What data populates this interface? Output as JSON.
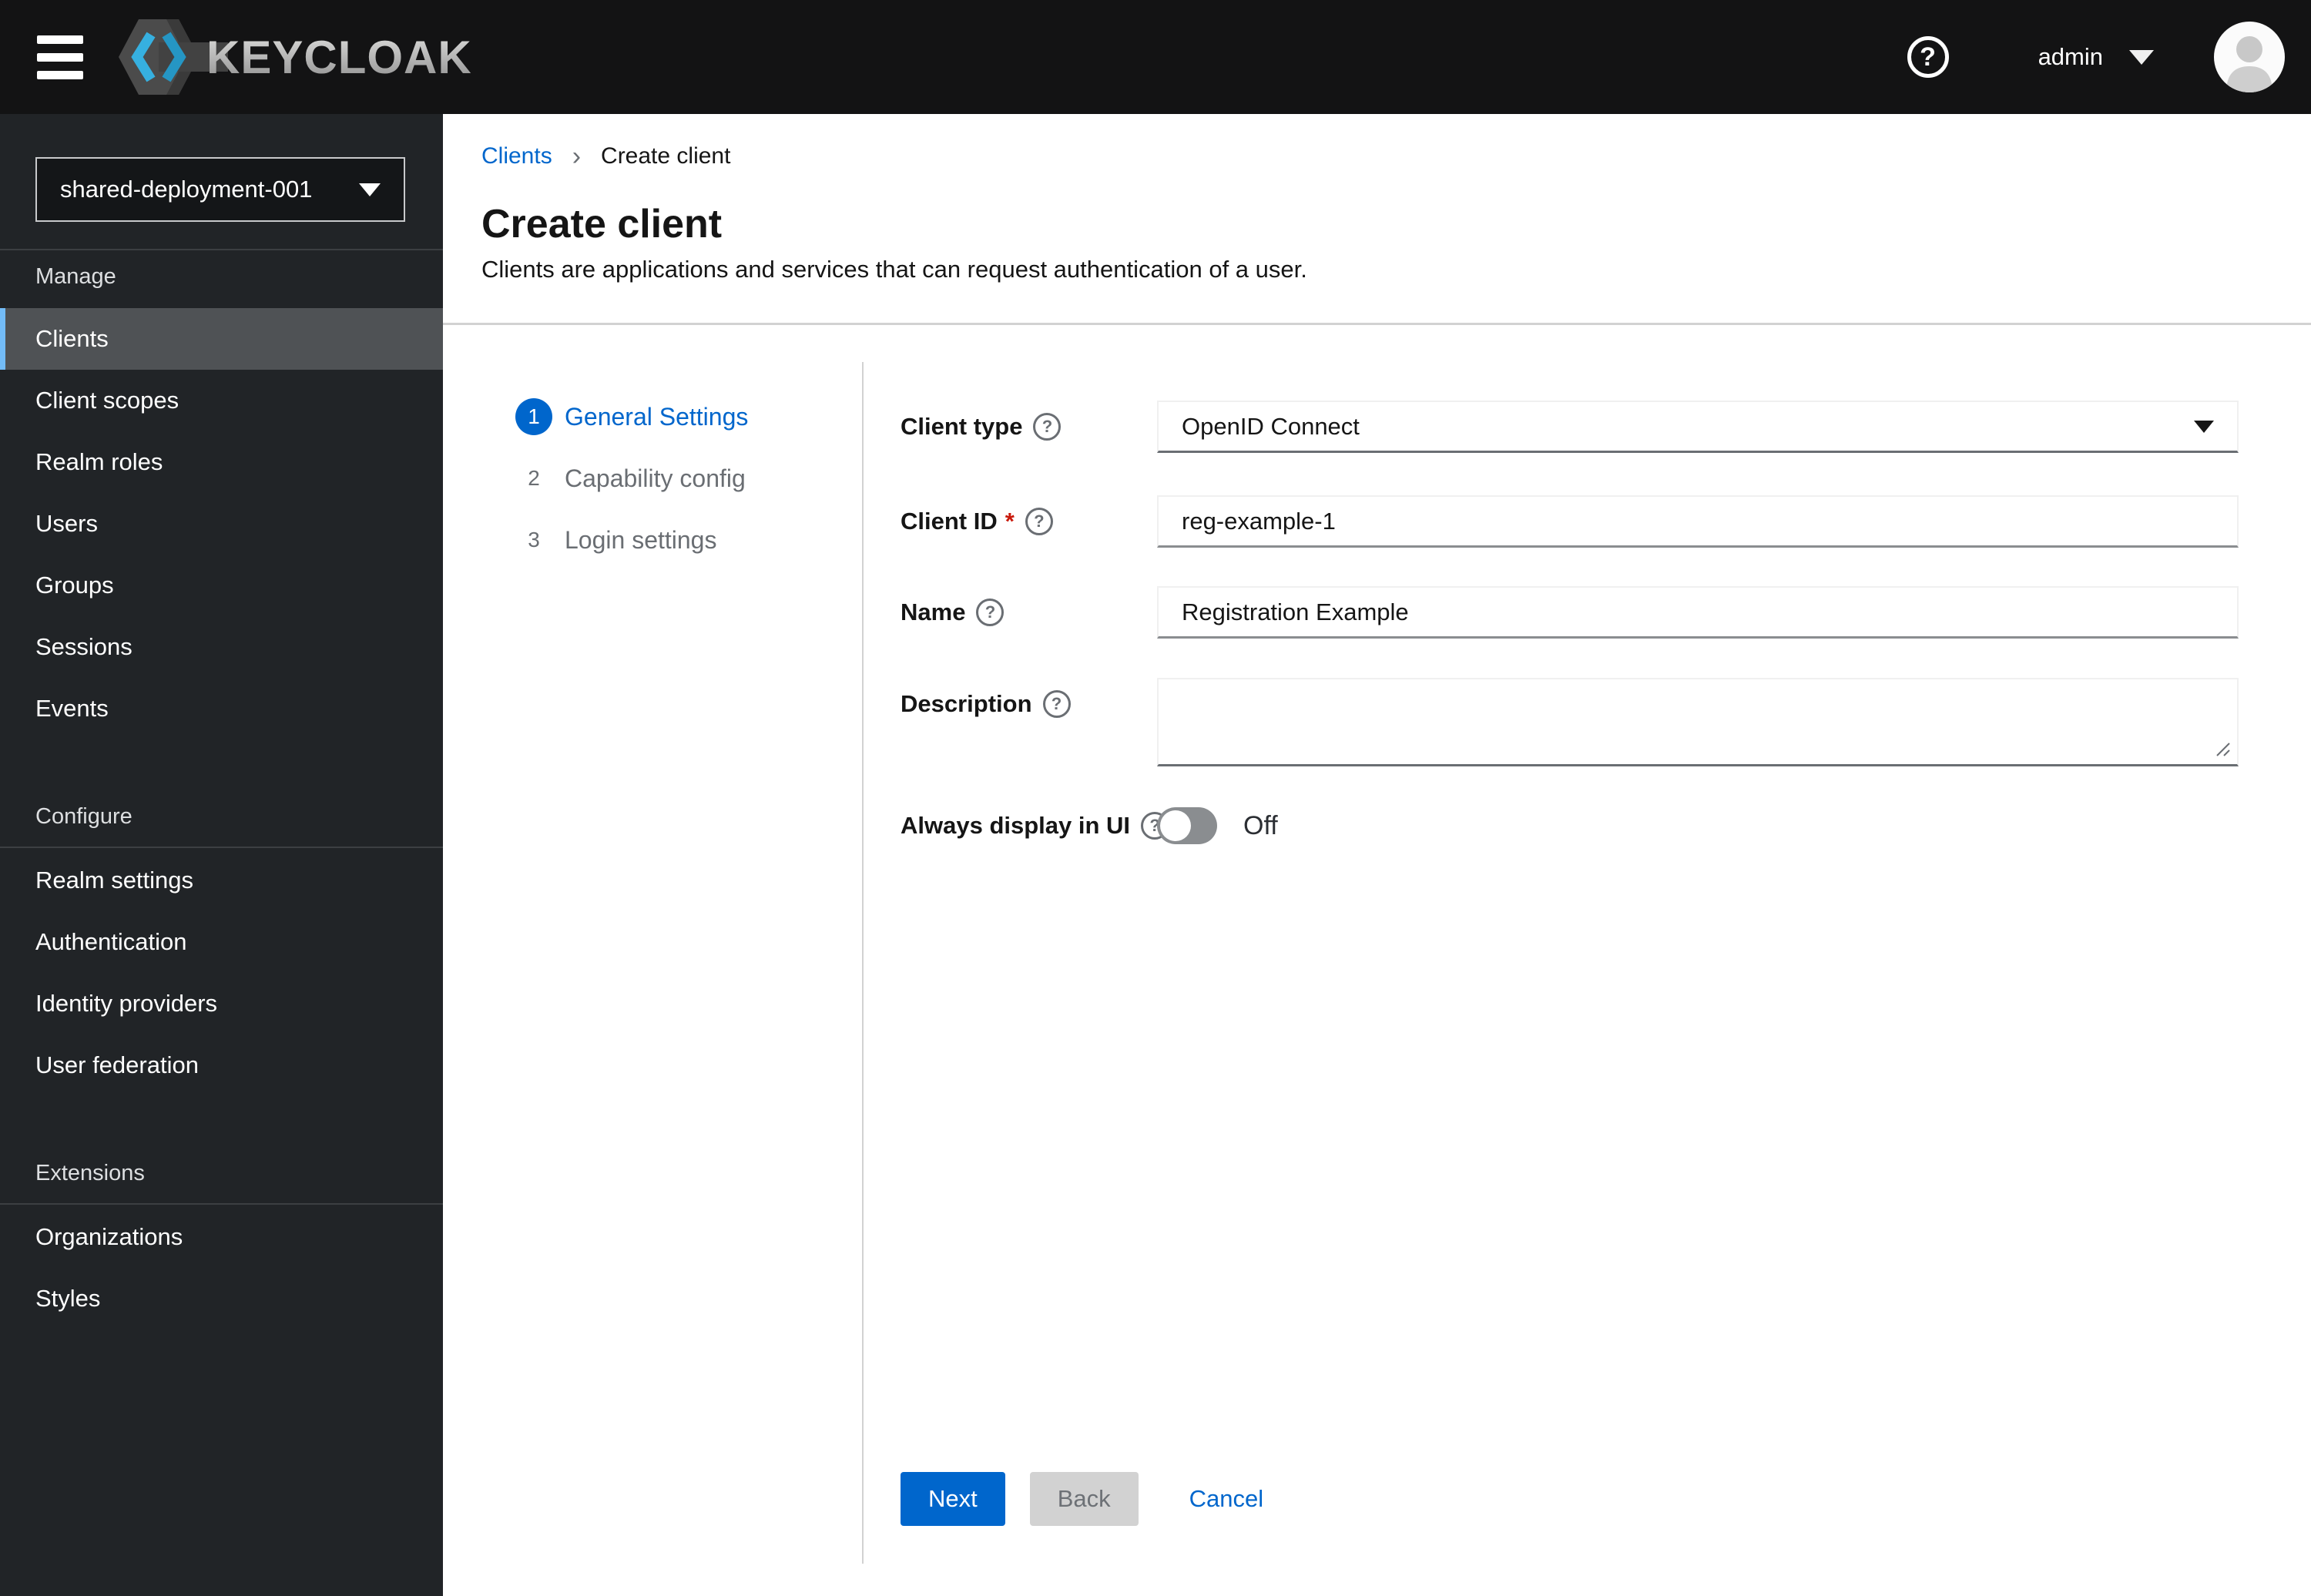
{
  "header": {
    "brand": "KEYCLOAK",
    "help_icon": "?",
    "user": {
      "name": "admin"
    }
  },
  "sidebar": {
    "realm": "shared-deployment-001",
    "sections": [
      {
        "title": "Manage",
        "items": [
          {
            "label": "Clients",
            "selected": true
          },
          {
            "label": "Client scopes"
          },
          {
            "label": "Realm roles"
          },
          {
            "label": "Users"
          },
          {
            "label": "Groups"
          },
          {
            "label": "Sessions"
          },
          {
            "label": "Events"
          }
        ]
      },
      {
        "title": "Configure",
        "items": [
          {
            "label": "Realm settings"
          },
          {
            "label": "Authentication"
          },
          {
            "label": "Identity providers"
          },
          {
            "label": "User federation"
          }
        ]
      },
      {
        "title": "Extensions",
        "items": [
          {
            "label": "Organizations"
          },
          {
            "label": "Styles"
          }
        ]
      }
    ]
  },
  "breadcrumb": {
    "separator": "›",
    "items": [
      {
        "label": "Clients",
        "link": true
      },
      {
        "label": "Create client",
        "current": true
      }
    ]
  },
  "page": {
    "title": "Create client",
    "subtitle": "Clients are applications and services that can request authentication of a user."
  },
  "wizard": {
    "steps": [
      {
        "number": "1",
        "label": "General Settings",
        "active": true
      },
      {
        "number": "2",
        "label": "Capability config"
      },
      {
        "number": "3",
        "label": "Login settings"
      }
    ]
  },
  "form": {
    "help_glyph": "?",
    "required_mark": "*",
    "client_type": {
      "label": "Client type",
      "value": "OpenID Connect"
    },
    "client_id": {
      "label": "Client ID",
      "value": "reg-example-1"
    },
    "name": {
      "label": "Name",
      "value": "Registration Example"
    },
    "description": {
      "label": "Description",
      "value": ""
    },
    "always_display": {
      "label": "Always display in UI",
      "state": "Off"
    }
  },
  "actions": {
    "next": "Next",
    "back": "Back",
    "cancel": "Cancel"
  },
  "colors": {
    "accent": "#0066cc",
    "nav_selected_border": "#73bcf7",
    "danger": "#c9190b",
    "masthead_bg": "#131314",
    "sidebar_bg": "#212427"
  }
}
